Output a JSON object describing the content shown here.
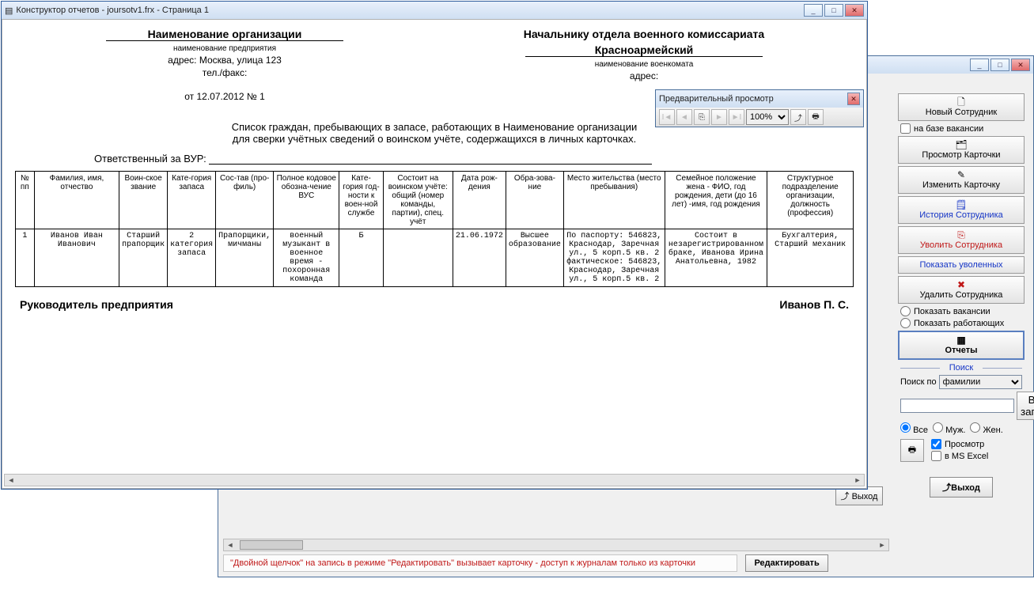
{
  "bgWindow": {
    "title": ""
  },
  "mainWindow": {
    "title": "Конструктор отчетов - joursotv1.frx - Страница 1"
  },
  "previewToolbar": {
    "title": "Предварительный просмотр",
    "zoom": "100%"
  },
  "sidepanel": {
    "newEmployee": "Новый Сотрудник",
    "basedOnVacancy": "на базе вакансии",
    "viewCard": "Просмотр Карточки",
    "editCard": "Изменить Карточку",
    "employeeHistory": "История Сотрудника",
    "fireEmployee": "Уволить Сотрудника",
    "showFired": "Показать уволенных",
    "deleteEmployee": "Удалить Сотрудника",
    "showVacancies": "Показать вакансии",
    "showWorking": "Показать работающих",
    "reports": "Отчеты",
    "searchGroup": "Поиск",
    "searchByLabel": "Поиск по",
    "searchByValue": "фамилии",
    "allRecords": "Все записи",
    "all": "Все",
    "male": "Муж.",
    "female": "Жен.",
    "preview": "Просмотр",
    "inExcel": "в MS Excel",
    "exit": "Выход"
  },
  "bgBottom": {
    "exit": "Выход",
    "hint": "\"Двойной щелчок\" на запись в режиме \"Редактировать\" вызывает карточку -  доступ к журналам только из карточки",
    "edit": "Редактировать"
  },
  "report": {
    "orgHeader": "Наименование организации",
    "orgSub": "наименование предприятия",
    "orgAddr": "адрес: Москва, улица 123",
    "orgTelFax": "тел./факс:",
    "dateNo": "от 12.07.2012   № 1",
    "chiefHeader": "Начальнику отдела военного комиссариата",
    "commissariat": "Красноармейский",
    "commissariatSub": "наименование военкомата",
    "commAddr": "адрес:",
    "description1": "Список граждан, пребывающих в запасе, работающих в Наименование организации",
    "description2": "для сверки учётных сведений о воинском учёте, содержащихся в личных карточках.",
    "responsible": "Ответственный за ВУР:",
    "headers": [
      "№ пп",
      "Фамилия, имя, отчество",
      "Воин-ское звание",
      "Кате-гория запаса",
      "Сос-тав (про-филь)",
      "Полное кодовое обозна-чение ВУС",
      "Кате-гория год-ности к воен-ной службе",
      "Состоит на воинском учёте: общий (номер команды, партии), спец. учёт",
      "Дата рож-дения",
      "Обра-зова-ние",
      "Место жительства (место пребывания)",
      "Семейное положение жена - ФИО, год рождения, дети (до 16 лет) -имя, год рождения",
      "Структурное подразделение организации, должность (профессия)"
    ],
    "row": [
      "1",
      "Иванов Иван Иванович",
      "Старший прапорщик",
      "2 категория запаса",
      "Прапорщики, мичманы",
      "военный музыкант в военное время - похоронная команда",
      "Б",
      "",
      "21.06.1972",
      "Высшее образование",
      "По паспорту: 546823, Краснодар, Заречная ул., 5 корп.5 кв. 2 фактическое: 546823, Краснодар, Заречная ул., 5 корп.5 кв. 2",
      "Состоит в незарегистрированном браке, Иванова Ирина Анатольевна, 1982",
      "Бухгалтерия, Старший механик"
    ],
    "footerLeft": "Руководитель предприятия",
    "footerRight": "Иванов П. С."
  }
}
